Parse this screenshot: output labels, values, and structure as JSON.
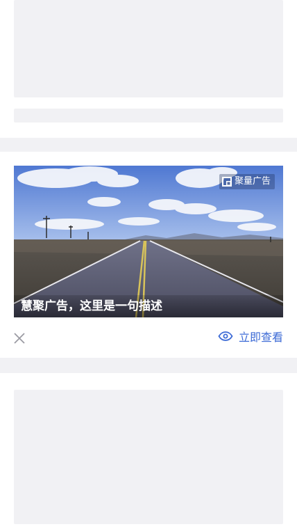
{
  "ad": {
    "badge_label": "聚量广告",
    "caption": "慧聚广告，这里是一句描述",
    "view_label": "立即查看"
  },
  "icons": {
    "badge": "ad-logo-icon",
    "close": "close-icon",
    "view": "eye-icon"
  },
  "colors": {
    "accent": "#3d6bd6",
    "placeholder": "#f1f1f4",
    "separator": "#f1f1f4"
  }
}
